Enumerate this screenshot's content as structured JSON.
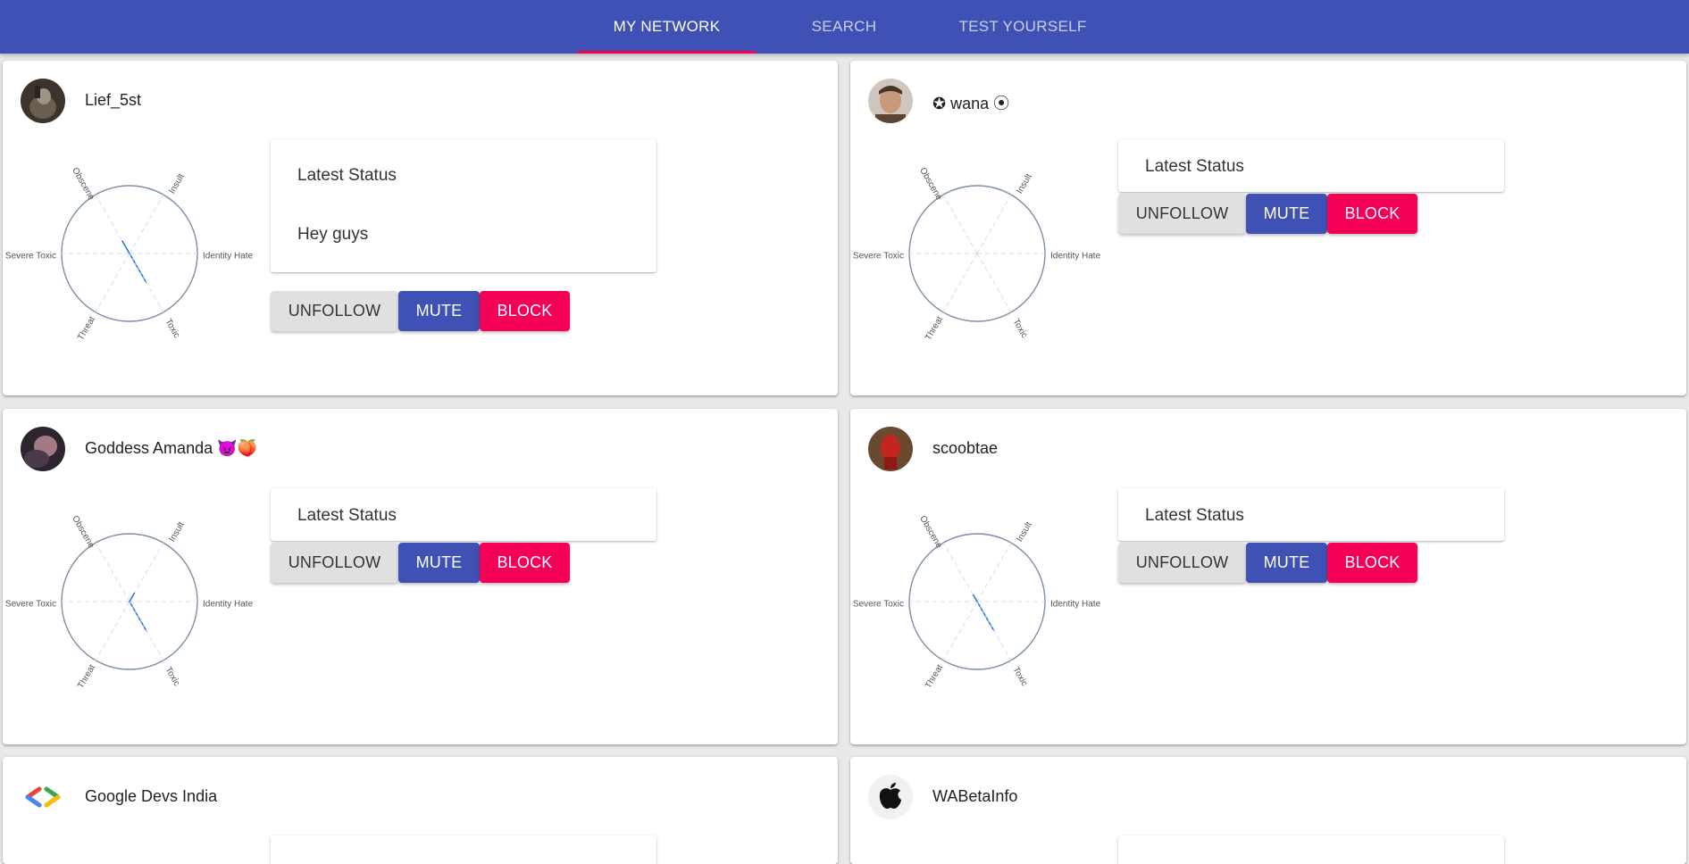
{
  "nav": {
    "tabs": [
      {
        "label": "MY NETWORK",
        "active": true
      },
      {
        "label": "SEARCH",
        "active": false
      },
      {
        "label": "TEST YOURSELF",
        "active": false
      }
    ]
  },
  "toxicity_axes": [
    "Insult",
    "Identity Hate",
    "Toxic",
    "Threat",
    "Severe Toxic",
    "Obscene"
  ],
  "cards": [
    {
      "name": "Lief_5st",
      "status_title": "Latest Status",
      "status_text": "Hey guys",
      "scores": [
        0,
        0,
        0.5,
        0,
        0,
        0.22
      ],
      "unfollow": "UNFOLLOW",
      "mute": "MUTE",
      "block": "BLOCK"
    },
    {
      "name": "✪ wana ⦿",
      "status_title": "Latest Status",
      "status_text": "",
      "scores": [
        0,
        0,
        0,
        0,
        0,
        0
      ],
      "unfollow": "UNFOLLOW",
      "mute": "MUTE",
      "block": "BLOCK"
    },
    {
      "name": "Goddess Amanda 😈🍑",
      "status_title": "Latest Status",
      "status_text": "",
      "scores": [
        0.15,
        0,
        0.5,
        0,
        0,
        0
      ],
      "unfollow": "UNFOLLOW",
      "mute": "MUTE",
      "block": "BLOCK"
    },
    {
      "name": "scoobtae",
      "status_title": "Latest Status",
      "status_text": "",
      "scores": [
        0,
        0,
        0.5,
        0,
        0,
        0.12
      ],
      "unfollow": "UNFOLLOW",
      "mute": "MUTE",
      "block": "BLOCK"
    },
    {
      "name": "Google Devs India"
    },
    {
      "name": "WABetaInfo"
    }
  ],
  "colors": {
    "appbar": "#3f51b5",
    "tab_indicator": "#f50057",
    "mute": "#3f51b5",
    "block": "#f50057",
    "unfollow": "#e0e0e0",
    "radar_fill": "#1e6fd9"
  }
}
